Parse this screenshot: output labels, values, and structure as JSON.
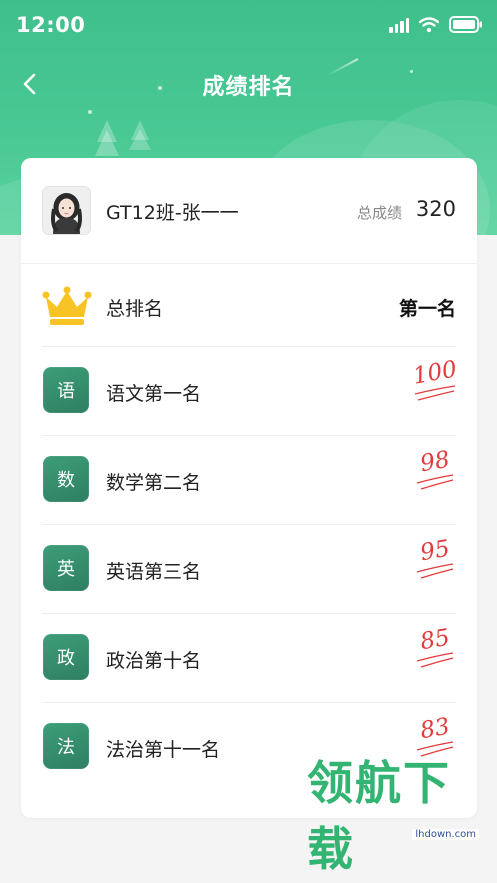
{
  "status_bar": {
    "time": "12:00"
  },
  "nav": {
    "title": "成绩排名"
  },
  "profile": {
    "student": "GT12班-张一一",
    "total_label": "总成绩",
    "total_value": "320"
  },
  "overall": {
    "label": "总排名",
    "value": "第一名"
  },
  "subjects": [
    {
      "badge": "语",
      "label": "语文第一名",
      "score": "100"
    },
    {
      "badge": "数",
      "label": "数学第二名",
      "score": "98"
    },
    {
      "badge": "英",
      "label": "英语第三名",
      "score": "95"
    },
    {
      "badge": "政",
      "label": "政治第十名",
      "score": "85"
    },
    {
      "badge": "法",
      "label": "法治第十一名",
      "score": "83"
    }
  ],
  "watermark": {
    "text": "领航下载",
    "url": "lhdown.com"
  },
  "colors": {
    "header_green": "#3fbf8c",
    "badge_green": "#3d9d79",
    "score_red": "#e23b3b",
    "crown_gold": "#f7c325"
  },
  "icons": [
    "back-arrow-icon",
    "signal-icon",
    "wifi-icon",
    "battery-icon",
    "crown-icon"
  ]
}
